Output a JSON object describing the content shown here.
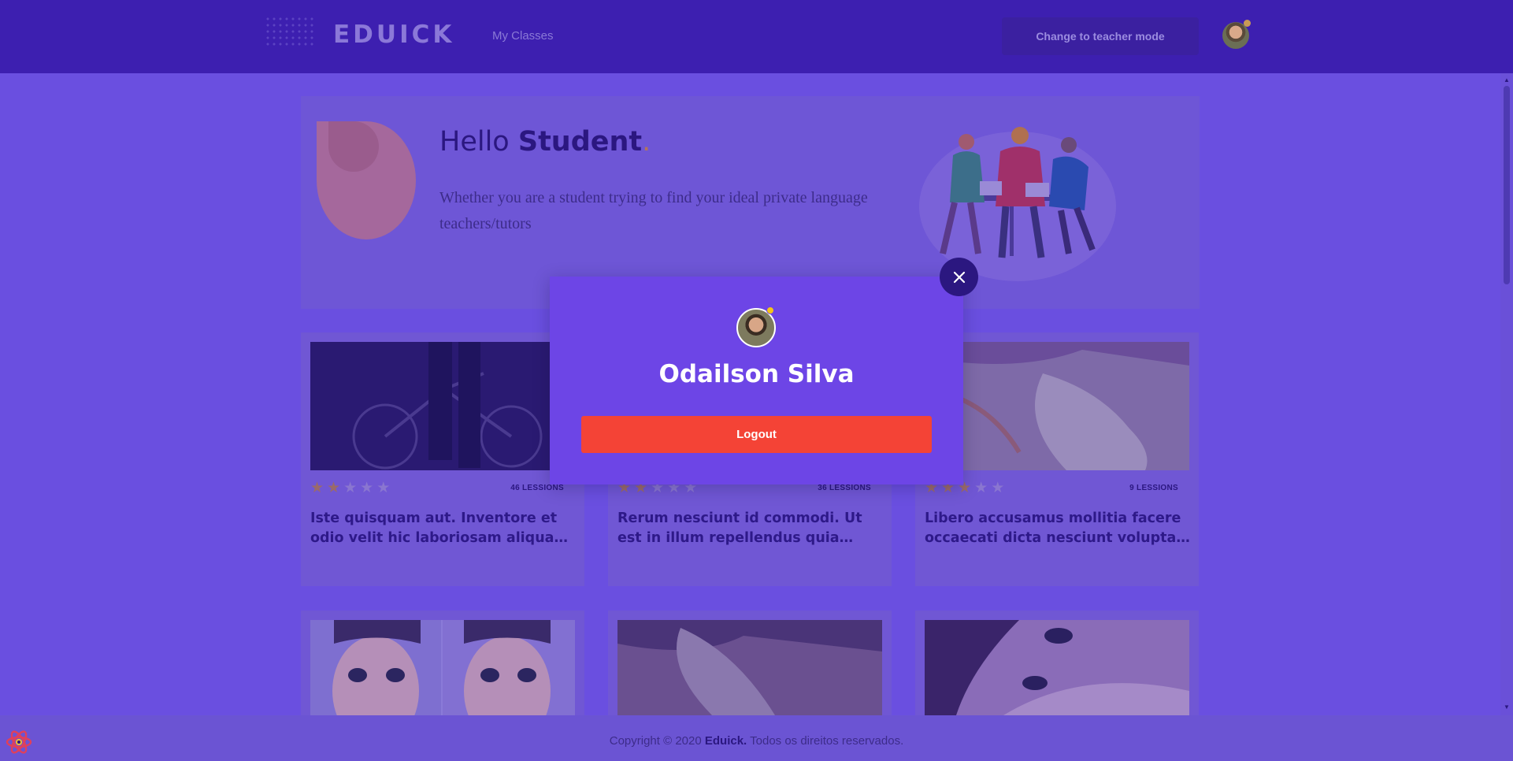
{
  "header": {
    "logo": "EDUICK",
    "nav_my_classes": "My Classes",
    "teacher_mode_label": "Change to teacher mode"
  },
  "hero": {
    "greeting": "Hello",
    "name": "Student",
    "period": ".",
    "subtitle": "Whether you are a student trying to find your ideal private language teachers/tutors"
  },
  "courses": [
    {
      "rating": 2,
      "lessons": "46 LESSIONS",
      "title": "Iste quisquam aut. Inventore et odio velit hic laboriosam aliquam non."
    },
    {
      "rating": 2,
      "lessons": "36 LESSIONS",
      "title": "Rerum nesciunt id commodi. Ut est in illum repellendus quia quia..."
    },
    {
      "rating": 3,
      "lessons": "9 LESSIONS",
      "title": "Libero accusamus mollitia facere occaecati dicta nesciunt voluptas i..."
    }
  ],
  "footer": {
    "prefix": "Copyright © 2020",
    "brand": "Eduick.",
    "suffix": "Todos os direitos reservados."
  },
  "modal": {
    "user_name": "Odailson Silva",
    "logout_label": "Logout"
  },
  "colors": {
    "header_bg": "#3d1fb0",
    "modal_bg": "#6d45e6",
    "logout_bg": "#f44336",
    "close_bg": "#2b1780"
  }
}
